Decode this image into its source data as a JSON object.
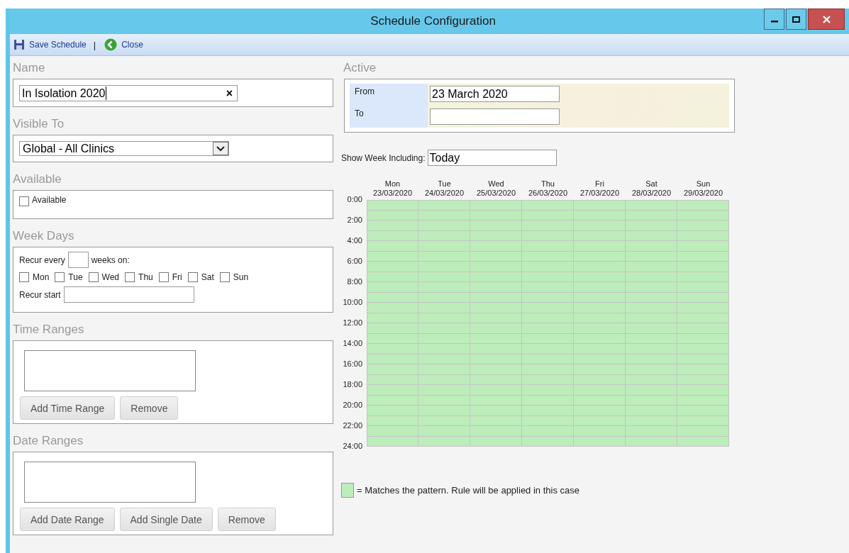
{
  "window": {
    "title": "Schedule Configuration"
  },
  "toolbar": {
    "items": [
      {
        "kind": "save",
        "label": "Save Schedule"
      },
      {
        "kind": "separator",
        "label": "|"
      },
      {
        "kind": "close",
        "label": "Close"
      }
    ]
  },
  "name": {
    "heading": "Name",
    "value": "In Isolation 2020",
    "clear": "×"
  },
  "visible_to": {
    "heading": "Visible To",
    "value": "Global - All Clinics"
  },
  "available": {
    "heading": "Available",
    "label": "Available",
    "checked": false
  },
  "week_days": {
    "heading": "Week Days",
    "recur_every_label": "Recur every",
    "recur_every_suffix": "weeks on:",
    "recur_start_label": "Recur start",
    "days": [
      {
        "label": "Mon",
        "checked": false
      },
      {
        "label": "Tue",
        "checked": false
      },
      {
        "label": "Wed",
        "checked": false
      },
      {
        "label": "Thu",
        "checked": false
      },
      {
        "label": "Fri",
        "checked": false
      },
      {
        "label": "Sat",
        "checked": false
      },
      {
        "label": "Sun",
        "checked": false
      }
    ]
  },
  "time_ranges": {
    "heading": "Time Ranges",
    "buttons": [
      "Add Time Range",
      "Remove"
    ]
  },
  "date_ranges": {
    "heading": "Date Ranges",
    "buttons": [
      "Add Date Range",
      "Add Single Date",
      "Remove"
    ]
  },
  "active": {
    "heading": "Active",
    "from_label": "From",
    "from_value": "23 March 2020",
    "to_label": "To"
  },
  "show_week": {
    "label": "Show Week Including:",
    "value": "Today"
  },
  "grid": {
    "time_labels": [
      "0:00",
      "2:00",
      "4:00",
      "6:00",
      "8:00",
      "10:00",
      "12:00",
      "14:00",
      "16:00",
      "18:00",
      "20:00",
      "22:00",
      "24:00"
    ],
    "days": [
      {
        "day": "Mon",
        "date": "23/03/2020",
        "hours": [
          true,
          true,
          true,
          true,
          true,
          true,
          true,
          true,
          true,
          true,
          true,
          true,
          true,
          true,
          true,
          true,
          true,
          true,
          true,
          true,
          true,
          true,
          true,
          true
        ]
      },
      {
        "day": "Tue",
        "date": "24/03/2020",
        "hours": [
          true,
          true,
          true,
          true,
          true,
          true,
          true,
          true,
          true,
          true,
          true,
          true,
          true,
          true,
          true,
          true,
          true,
          true,
          true,
          true,
          true,
          true,
          true,
          true
        ]
      },
      {
        "day": "Wed",
        "date": "25/03/2020",
        "hours": [
          true,
          true,
          true,
          true,
          true,
          true,
          true,
          true,
          true,
          true,
          true,
          true,
          true,
          true,
          true,
          true,
          true,
          true,
          true,
          true,
          true,
          true,
          true,
          true
        ]
      },
      {
        "day": "Thu",
        "date": "26/03/2020",
        "hours": [
          true,
          true,
          true,
          true,
          true,
          true,
          true,
          true,
          true,
          true,
          true,
          true,
          true,
          true,
          true,
          true,
          true,
          true,
          true,
          true,
          true,
          true,
          true,
          true
        ]
      },
      {
        "day": "Fri",
        "date": "27/03/2020",
        "hours": [
          true,
          true,
          true,
          true,
          true,
          true,
          true,
          true,
          true,
          true,
          true,
          true,
          true,
          true,
          true,
          true,
          true,
          true,
          true,
          true,
          true,
          true,
          true,
          true
        ]
      },
      {
        "day": "Sat",
        "date": "28/03/2020",
        "hours": [
          true,
          true,
          true,
          true,
          true,
          true,
          true,
          true,
          true,
          true,
          true,
          true,
          true,
          true,
          true,
          true,
          true,
          true,
          true,
          true,
          true,
          true,
          true,
          true
        ]
      },
      {
        "day": "Sun",
        "date": "29/03/2020",
        "hours": [
          true,
          true,
          true,
          true,
          true,
          true,
          true,
          true,
          true,
          true,
          true,
          true,
          true,
          true,
          true,
          true,
          true,
          true,
          true,
          true,
          true,
          true,
          true,
          true
        ]
      }
    ]
  },
  "legend": {
    "text": "= Matches the pattern. Rule will be applied in this case"
  }
}
